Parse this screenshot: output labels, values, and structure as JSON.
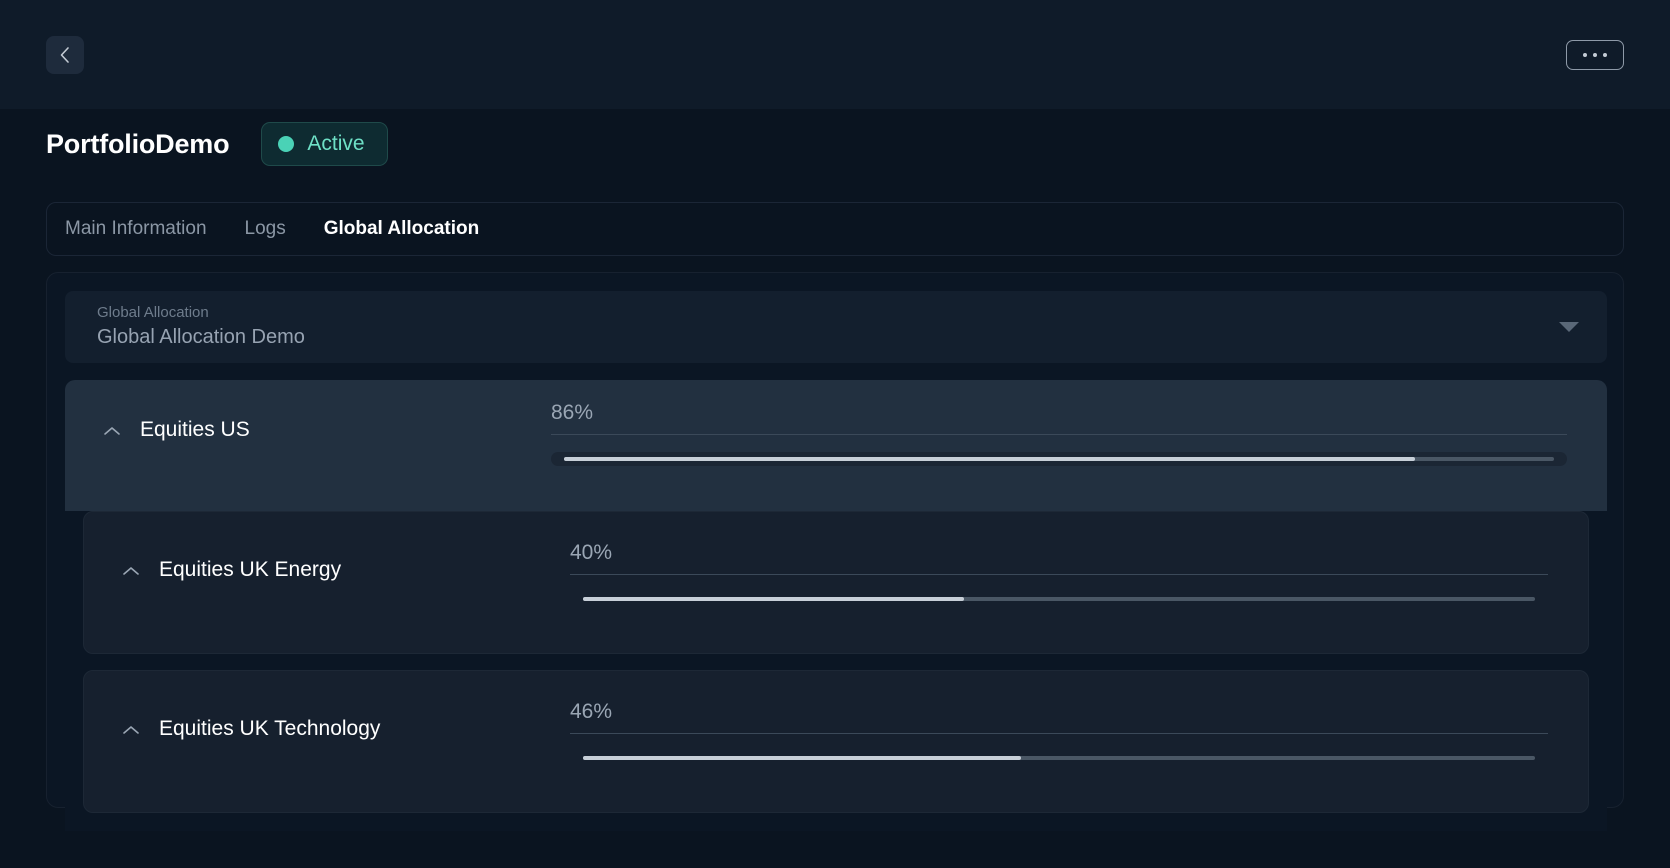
{
  "topbar": {
    "back_icon": "chevron-left-icon",
    "more_icon": "ellipsis-icon"
  },
  "header": {
    "title": "PortfolioDemo",
    "status": {
      "label": "Active",
      "dot_color": "#4ad2b6",
      "text_color": "#6ee0c6",
      "bg_color": "#0e2b31"
    }
  },
  "tabs": [
    {
      "label": "Main Information",
      "active": false
    },
    {
      "label": "Logs",
      "active": false
    },
    {
      "label": "Global Allocation",
      "active": true
    }
  ],
  "select": {
    "label": "Global Allocation",
    "value": "Global Allocation Demo",
    "caret_icon": "caret-down-icon"
  },
  "allocations": [
    {
      "name": "Equities US",
      "percent_text": "86%",
      "percent_value": 86,
      "collapse_icon": "chevron-up-icon",
      "level": 0
    },
    {
      "name": "Equities UK Energy",
      "percent_text": "40%",
      "percent_value": 40,
      "collapse_icon": "chevron-up-icon",
      "level": 1
    },
    {
      "name": "Equities UK Technology",
      "percent_text": "46%",
      "percent_value": 46,
      "collapse_icon": "chevron-up-icon",
      "level": 1
    }
  ],
  "colors": {
    "page_bg": "#0a1420",
    "topbar_bg": "#0f1b29",
    "card_bg": "#0b1624",
    "row_bg": "#223040",
    "nested_row_bg": "#16202e",
    "accent": "#4ad2b6",
    "slider_fill": "#c7cfd8",
    "slider_rail": "#4a5765"
  }
}
